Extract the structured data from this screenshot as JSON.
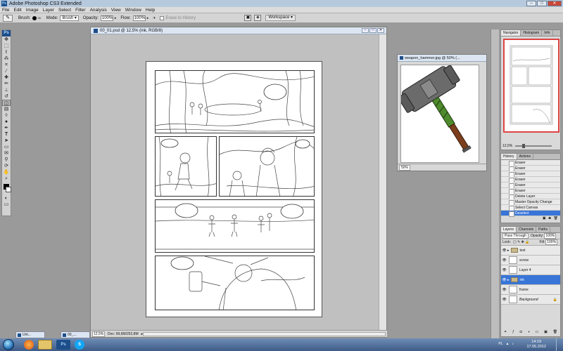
{
  "app": {
    "title": "Adobe Photoshop CS3 Extended",
    "logo": "Ps"
  },
  "menu": [
    "File",
    "Edit",
    "Image",
    "Layer",
    "Select",
    "Filter",
    "Analysis",
    "View",
    "Window",
    "Help"
  ],
  "options": {
    "brush_label": "Brush:",
    "brush_size": "35",
    "mode_label": "Mode:",
    "mode_value": "Brush",
    "opacity_label": "Opacity:",
    "opacity_value": "100%",
    "flow_label": "Flow:",
    "flow_value": "100%",
    "erase_history": "Erase to History",
    "workspace": "Workspace ▾"
  },
  "document": {
    "title": "00_01.psd @ 12,5% (ink, RGB/8)",
    "zoom": "12,5%",
    "doc_size": "Doc: 99,6M/252,8M"
  },
  "hammer_window": {
    "title": "weapon_hammer.jpg @ 50% (...",
    "zoom": "50%"
  },
  "navigator": {
    "tabs": [
      "Navigator",
      "Histogram",
      "Info"
    ],
    "zoom": "12,5%"
  },
  "history": {
    "tabs": [
      "History",
      "Actions"
    ],
    "items": [
      "Eraser",
      "Eraser",
      "Eraser",
      "Eraser",
      "Eraser",
      "Eraser",
      "Delete Layer",
      "Master Opacity Change",
      "Select Canvas",
      "Deselect"
    ],
    "selected_index": 9
  },
  "layers": {
    "tabs": [
      "Layers",
      "Channels",
      "Paths"
    ],
    "blend_mode": "Pass Through",
    "opacity_label": "Opacity:",
    "opacity_value": "100%",
    "lock_label": "Lock:",
    "fill_label": "Fill:",
    "fill_value": "100%",
    "rows": [
      {
        "name": "text",
        "type": "folder",
        "selected": false
      },
      {
        "name": "screw",
        "type": "layer",
        "selected": false
      },
      {
        "name": "Layer 4",
        "type": "layer",
        "selected": false
      },
      {
        "name": "ink",
        "type": "folder",
        "selected": true
      },
      {
        "name": "frame",
        "type": "layer",
        "selected": false
      },
      {
        "name": "Background",
        "type": "layer",
        "selected": false
      }
    ]
  },
  "taskbar": {
    "min_windows": [
      "Unt...",
      "00_..."
    ],
    "lang": "PL",
    "time": "14:19",
    "date": "17.05.2012"
  },
  "colors": {
    "selection": "#3875d7",
    "ps_brand": "#1d4e89",
    "nav_box": "#dd4444"
  }
}
